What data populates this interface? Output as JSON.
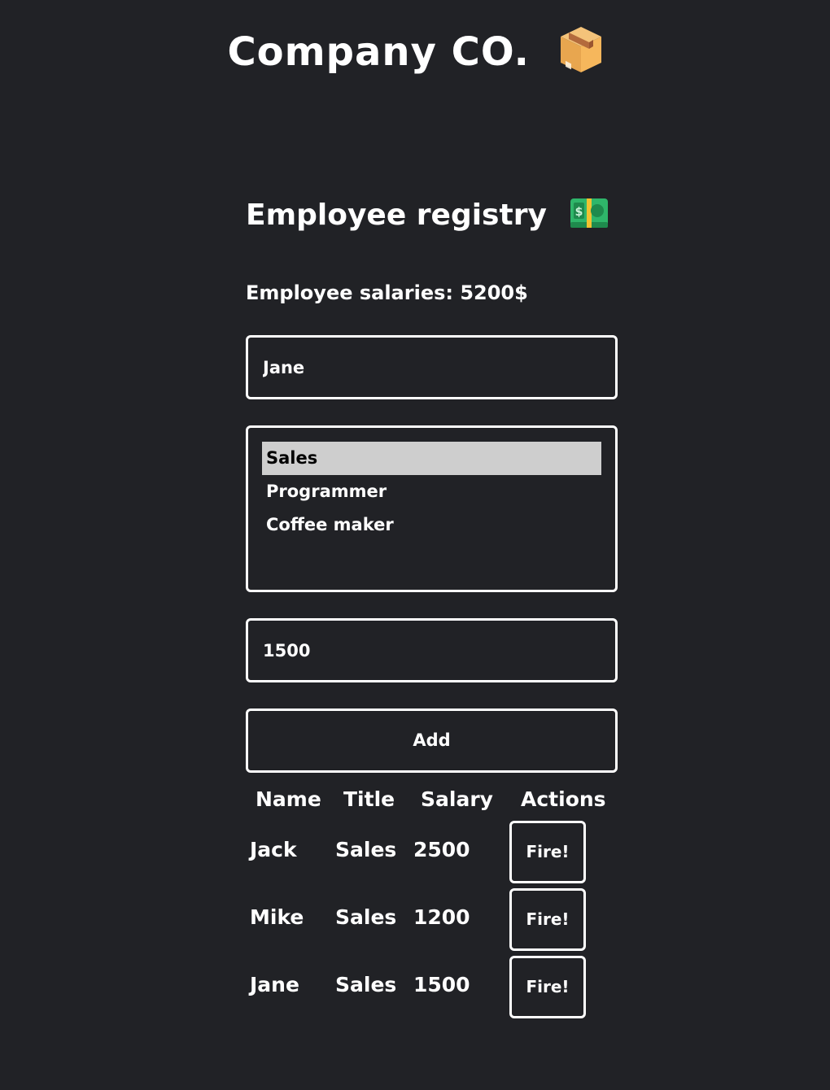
{
  "header": {
    "brand": "Company CO.",
    "brand_icon": "package-box-icon"
  },
  "registry": {
    "title": "Employee registry",
    "title_icon": "dollar-banknote-icon",
    "total_label": "Employee salaries: 5200$"
  },
  "form": {
    "name_value": "Jane",
    "title_options": [
      "Sales",
      "Programmer",
      "Coffee maker"
    ],
    "selected_title": "Sales",
    "salary_value": "1500",
    "add_label": "Add"
  },
  "table": {
    "headers": [
      "Name",
      "Title",
      "Salary",
      "Actions"
    ],
    "rows": [
      {
        "name": "Jack",
        "title": "Sales",
        "salary": "2500",
        "action": "Fire!"
      },
      {
        "name": "Mike",
        "title": "Sales",
        "salary": "1200",
        "action": "Fire!"
      },
      {
        "name": "Jane",
        "title": "Sales",
        "salary": "1500",
        "action": "Fire!"
      }
    ]
  },
  "colors": {
    "background": "#212226",
    "foreground": "#ffffff",
    "selected_option_bg": "#cecece"
  }
}
